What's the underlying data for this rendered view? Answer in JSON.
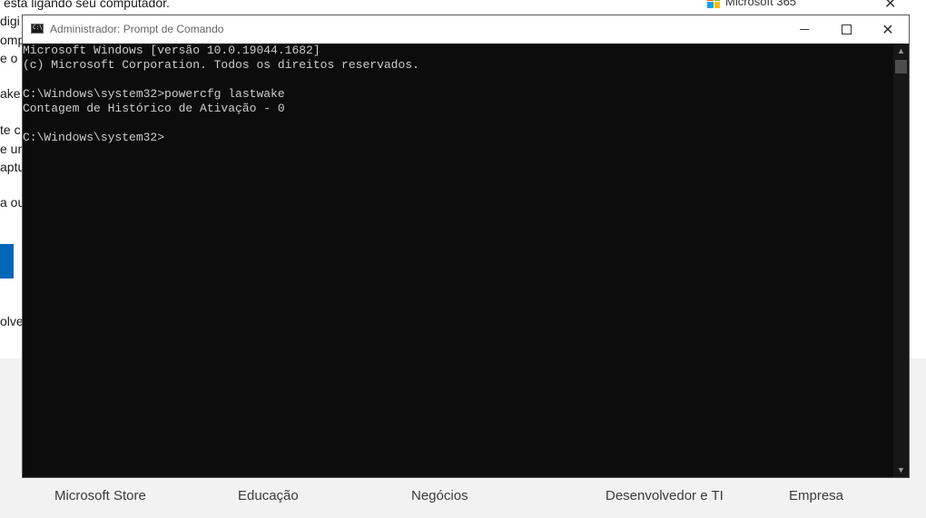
{
  "background_page": {
    "top_fragment": "está ligando seu computador.",
    "left_fragments": [
      "digi",
      "omp",
      "e o s",
      "ake",
      "te c",
      "e un",
      "aptu",
      "a ou",
      "olve"
    ],
    "ms365_label": "Microsoft 365",
    "close_symbol": "✕",
    "footer_links": [
      "Microsoft Store",
      "Educação",
      "Negócios",
      "Desenvolvedor e TI",
      "Empresa"
    ]
  },
  "window": {
    "title": "Administrador: Prompt de Comando",
    "icon_text": "C:\\",
    "buttons": {
      "close_symbol": "✕"
    }
  },
  "console_lines": [
    "Microsoft Windows [versão 10.0.19044.1682]",
    "(c) Microsoft Corporation. Todos os direitos reservados.",
    "",
    "C:\\Windows\\system32>powercfg lastwake",
    "Contagem de Histórico de Ativação - 0",
    "",
    "C:\\Windows\\system32>"
  ],
  "scrollbar": {
    "up_arrow": "▲",
    "down_arrow": "▼"
  }
}
